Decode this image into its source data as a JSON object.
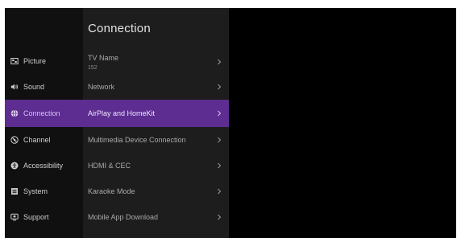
{
  "sidebar": {
    "items": [
      {
        "label": "Picture",
        "icon": "picture-icon"
      },
      {
        "label": "Sound",
        "icon": "speaker-icon"
      },
      {
        "label": "Connection",
        "icon": "globe-icon",
        "active": true
      },
      {
        "label": "Channel",
        "icon": "satellite-dish-icon"
      },
      {
        "label": "Accessibility",
        "icon": "accessibility-icon"
      },
      {
        "label": "System",
        "icon": "system-icon"
      },
      {
        "label": "Support",
        "icon": "support-icon"
      }
    ]
  },
  "panel": {
    "title": "Connection",
    "items": [
      {
        "label": "TV Name",
        "sub": "152"
      },
      {
        "label": "Network"
      },
      {
        "label": "AirPlay and HomeKit",
        "active": true
      },
      {
        "label": "Multimedia Device Connection"
      },
      {
        "label": "HDMI & CEC"
      },
      {
        "label": "Karaoke Mode"
      },
      {
        "label": "Mobile App Download"
      }
    ]
  },
  "colors": {
    "accent": "#5d2d91",
    "sidebar_bg": "#101010",
    "panel_bg": "#1d1d1d",
    "screen_bg": "#000000"
  }
}
